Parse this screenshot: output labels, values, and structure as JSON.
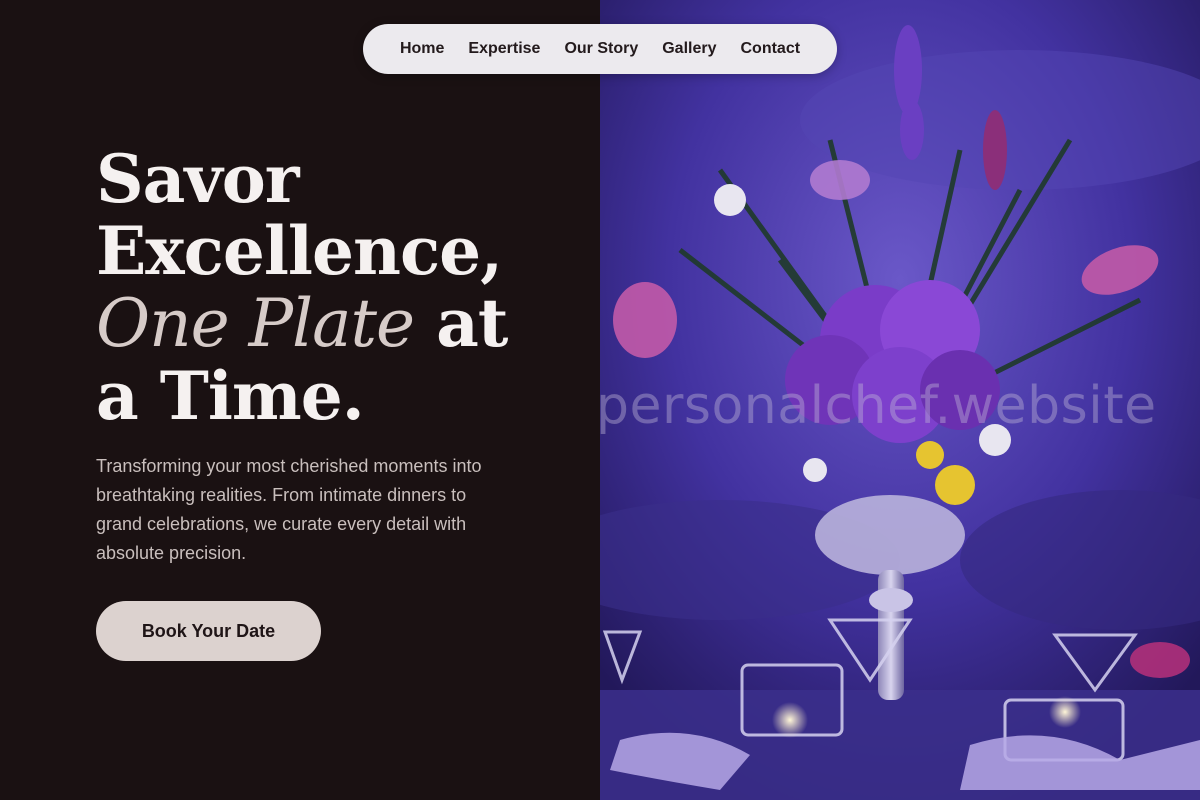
{
  "nav": {
    "items": [
      {
        "label": "Home"
      },
      {
        "label": "Expertise"
      },
      {
        "label": "Our Story"
      },
      {
        "label": "Gallery"
      },
      {
        "label": "Contact"
      }
    ]
  },
  "hero": {
    "headline": {
      "line1": "Savor",
      "line2": "Excellence,",
      "line3_accent": "One Plate",
      "line3_rest": " at",
      "line4": "a Time."
    },
    "description": "Transforming your most cherished moments into breathtaking realities. From intimate dinners to grand celebrations, we curate every detail with absolute precision.",
    "cta_label": "Book Your Date"
  },
  "photo": {
    "watermark": "personalchef.website",
    "subject": "purple floral centerpiece on dinner table"
  },
  "colors": {
    "background": "#1a1112",
    "headline": "#f5f1f0",
    "accent": "#d6cbc8",
    "cta_bg": "#dcd2cf",
    "nav_bg": "#eceaee",
    "photo_purple": "#4a3aa0"
  }
}
